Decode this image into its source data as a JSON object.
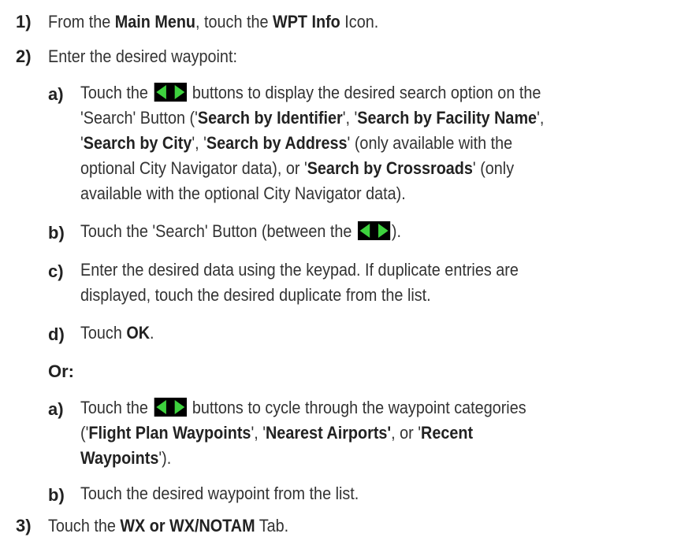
{
  "colors": {
    "arrow_bg": "#000000",
    "arrow_fill": "#3ed23e",
    "text": "#333333"
  },
  "steps": {
    "s1": {
      "num": "1)",
      "t1": "From the ",
      "b1": "Main Menu",
      "t2": ", touch the ",
      "b2": "WPT Info",
      "t3": " Icon."
    },
    "s2": {
      "num": "2)",
      "text": "Enter the desired waypoint:",
      "a": {
        "label": "a)",
        "l1_pre": "Touch the ",
        "l1_post": " buttons to display the desired search option on the",
        "l2_pre": "'Search' Button ('",
        "l2_b1": "Search by Identifier",
        "l2_mid": "', '",
        "l2_b2": "Search by Facility Name",
        "l2_end": "',",
        "l3_pre": "'",
        "l3_b1": "Search by City",
        "l3_mid": "',  '",
        "l3_b2": "Search by Address",
        "l3_end": "' (only available with the",
        "l4_pre": "optional City Navigator data), or '",
        "l4_b1": "Search by Crossroads",
        "l4_end": "' (only",
        "l5": "available with the optional City Navigator data)."
      },
      "b": {
        "label": "b)",
        "pre": "Touch the 'Search' Button (between the ",
        "post": ")."
      },
      "c": {
        "label": "c)",
        "l1": "Enter the desired data using the keypad.  If duplicate entries are",
        "l2": "displayed, touch the desired duplicate from the list."
      },
      "d": {
        "label": "d)",
        "pre": "Touch ",
        "b1": "OK",
        "post": "."
      },
      "or": "Or:",
      "a2": {
        "label": "a)",
        "l1_pre": "Touch the ",
        "l1_post": " buttons to cycle through the waypoint categories",
        "l2_pre": "('",
        "l2_b1": "Flight Plan Waypoints",
        "l2_mid": "', '",
        "l2_b2": "Nearest Airports'",
        "l2_end": ", or '",
        "l2_b3": "Recent",
        "l3_b": "Waypoints",
        "l3_end": "')."
      },
      "b2": {
        "label": "b)",
        "text": "Touch the desired waypoint from the list."
      }
    },
    "s3": {
      "num": "3)",
      "t1": "Touch the ",
      "b1": "WX or WX/NOTAM",
      "t2": " Tab."
    }
  }
}
